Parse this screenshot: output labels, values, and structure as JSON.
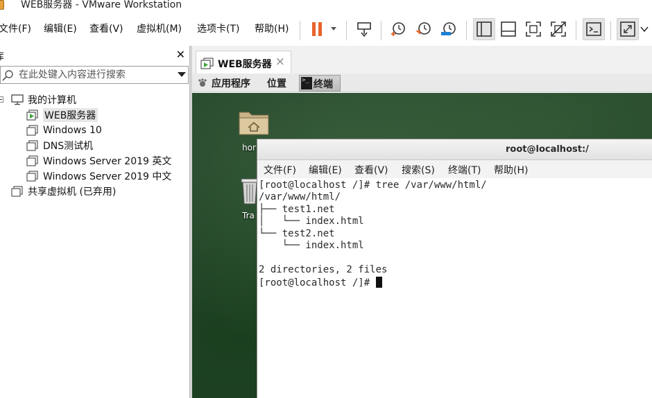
{
  "window": {
    "title": "WEB服务器 - VMware Workstation"
  },
  "menu": {
    "file": "文件(F)",
    "edit": "编辑(E)",
    "view": "查看(V)",
    "vm": "虚拟机(M)",
    "tabs": "选项卡(T)",
    "help": "帮助(H)"
  },
  "toolbar": {
    "buttons": [
      "pause",
      "send-ctrl-alt-del",
      "snapshot",
      "revert-snapshot",
      "snapshot-manager",
      "show-library",
      "show-thumbnail-bar",
      "full-screen",
      "unity",
      "console-view",
      "stretch-guest"
    ],
    "accent_color": "#e8632a",
    "snapshot_color": "#1f7fd4"
  },
  "library": {
    "header_label": "库",
    "search_placeholder": "在此处键入内容进行搜索",
    "root": "我的计算机",
    "vms": [
      "WEB服务器",
      "Windows 10",
      "DNS测试机",
      "Windows Server 2019 英文",
      "Windows Server 2019 中文"
    ],
    "selected_vm": "WEB服务器",
    "shared": "共享虚拟机 (已弃用)"
  },
  "vm_tab": {
    "label": "WEB服务器",
    "close": "×"
  },
  "guest_panel": {
    "applications": "应用程序",
    "places": "位置",
    "terminal_task": "终端"
  },
  "desktop": {
    "home_label": "hor",
    "trash_label": "Tra"
  },
  "terminal": {
    "title": "root@localhost:/",
    "menu": [
      "文件(F)",
      "编辑(E)",
      "查看(V)",
      "搜索(S)",
      "终端(T)",
      "帮助(H)"
    ],
    "lines": [
      "[root@localhost /]# tree /var/www/html/",
      "/var/www/html/",
      "├── test1.net",
      "│   └── index.html",
      "└── test2.net",
      "    └── index.html",
      "",
      "2 directories, 2 files",
      "[root@localhost /]# "
    ]
  },
  "colors": {
    "desktop_bg": "#24442a",
    "vm_running": "#3aa63a"
  }
}
